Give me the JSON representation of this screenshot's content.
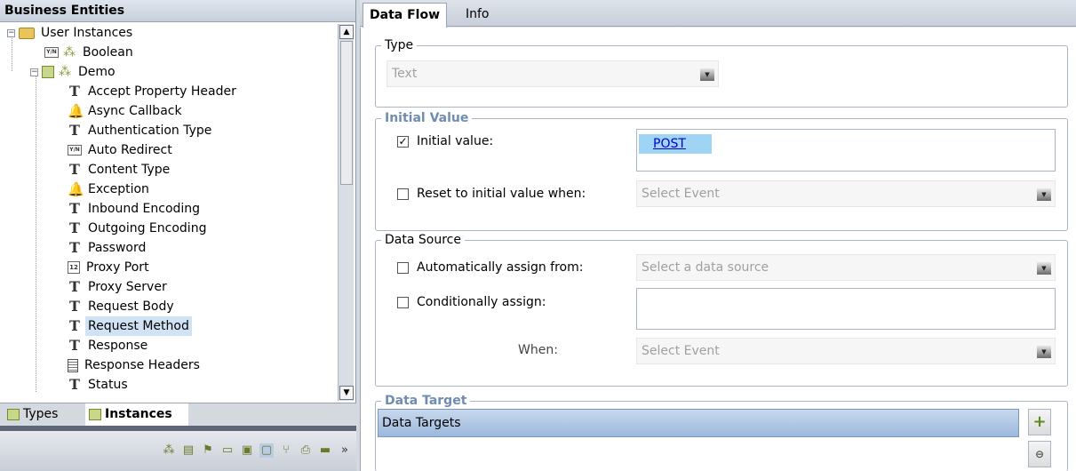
{
  "left_panel": {
    "title": "Business Entities",
    "tree": [
      {
        "label": "User Instances",
        "icon": "folder-icon",
        "depth": 0,
        "expanded": true
      },
      {
        "label": "Boolean",
        "icon": "yes-no-icon",
        "depth": 1
      },
      {
        "label": "Demo",
        "icon": "entity-folder-icon",
        "depth": 1,
        "expanded": true
      },
      {
        "label": "Accept Property Header",
        "icon": "text-type-icon",
        "depth": 2
      },
      {
        "label": "Async Callback",
        "icon": "bell-icon",
        "depth": 2
      },
      {
        "label": "Authentication Type",
        "icon": "text-type-icon",
        "depth": 2
      },
      {
        "label": "Auto Redirect",
        "icon": "yes-no-icon",
        "depth": 2
      },
      {
        "label": "Content Type",
        "icon": "text-type-icon",
        "depth": 2
      },
      {
        "label": "Exception",
        "icon": "bell-icon",
        "depth": 2
      },
      {
        "label": "Inbound Encoding",
        "icon": "text-type-icon",
        "depth": 2
      },
      {
        "label": "Outgoing Encoding",
        "icon": "text-type-icon",
        "depth": 2
      },
      {
        "label": "Password",
        "icon": "text-type-icon",
        "depth": 2
      },
      {
        "label": "Proxy Port",
        "icon": "number-type-icon",
        "depth": 2
      },
      {
        "label": "Proxy Server",
        "icon": "text-type-icon",
        "depth": 2
      },
      {
        "label": "Request Body",
        "icon": "text-type-icon",
        "depth": 2
      },
      {
        "label": "Request Method",
        "icon": "text-type-icon",
        "depth": 2,
        "selected": true
      },
      {
        "label": "Response",
        "icon": "text-type-icon",
        "depth": 2
      },
      {
        "label": "Response Headers",
        "icon": "document-icon",
        "depth": 2
      },
      {
        "label": "Status",
        "icon": "text-type-icon",
        "depth": 2
      }
    ],
    "tabs": [
      {
        "label": "Types",
        "active": false
      },
      {
        "label": "Instances",
        "active": true
      }
    ]
  },
  "right_panel": {
    "tabs": [
      {
        "label": "Data Flow",
        "active": true
      },
      {
        "label": "Info",
        "active": false
      }
    ],
    "type_group": {
      "legend": "Type",
      "dropdown_value": "Text"
    },
    "initial_value_group": {
      "legend": "Initial Value",
      "initial_value_label": "Initial value:",
      "initial_value_checked": true,
      "initial_value_chip": "POST",
      "reset_label": "Reset to initial value when:",
      "reset_checked": false,
      "reset_placeholder": "Select Event"
    },
    "data_source_group": {
      "legend": "Data Source",
      "auto_assign_label": "Automatically assign from:",
      "auto_assign_checked": false,
      "auto_assign_placeholder": "Select a data source",
      "cond_assign_label": "Conditionally assign:",
      "cond_assign_checked": false,
      "when_label": "When:",
      "when_placeholder": "Select Event"
    },
    "data_target_group": {
      "legend": "Data Target",
      "header": "Data Targets"
    }
  },
  "colors": {
    "accent_blue": "#6f8cb3",
    "selection": "#cfe3f4",
    "chip": "#9fd4f5"
  }
}
